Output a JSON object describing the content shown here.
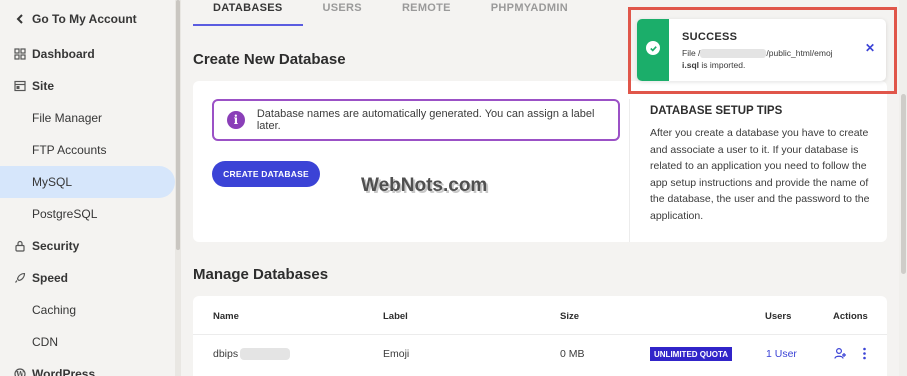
{
  "sidebar": {
    "back_label": "Go To My Account",
    "items": [
      {
        "label": "Dashboard"
      },
      {
        "label": "Site"
      },
      {
        "label": "File Manager"
      },
      {
        "label": "FTP Accounts"
      },
      {
        "label": "MySQL"
      },
      {
        "label": "PostgreSQL"
      },
      {
        "label": "Security"
      },
      {
        "label": "Speed"
      },
      {
        "label": "Caching"
      },
      {
        "label": "CDN"
      },
      {
        "label": "WordPress"
      }
    ]
  },
  "tabs": [
    {
      "label": "DATABASES"
    },
    {
      "label": "USERS"
    },
    {
      "label": "REMOTE"
    },
    {
      "label": "PHPMYADMIN"
    }
  ],
  "create": {
    "title": "Create New Database",
    "notice": "Database names are automatically generated. You can assign a label later.",
    "button": "CREATE DATABASE",
    "watermark": "WebNots.com",
    "tips_title": "DATABASE SETUP TIPS",
    "tips_body": "After you create a database you have to create and associate a user to it. If your database is related to an application you need to follow the app setup instructions and provide the name of the database, the user and the password to the application."
  },
  "manage": {
    "title": "Manage Databases",
    "headers": {
      "name": "Name",
      "label": "Label",
      "size": "Size",
      "users": "Users",
      "actions": "Actions"
    },
    "rows": [
      {
        "name": "dbips",
        "label": "Emoji",
        "size": "0 MB",
        "quota": "UNLIMITED QUOTA",
        "users": "1 User"
      }
    ]
  },
  "toast": {
    "title": "SUCCESS",
    "msg_prefix": "File /",
    "msg_path": "/public_html/emoj",
    "msg_file": "i.sql",
    "msg_suffix": " is imported.",
    "close": "✕"
  },
  "colors": {
    "accent": "#3b43d6",
    "success": "#1bae6a",
    "notice_border": "#9b51c6",
    "quota_bg": "#3124c9",
    "highlight": "#e0564a"
  }
}
